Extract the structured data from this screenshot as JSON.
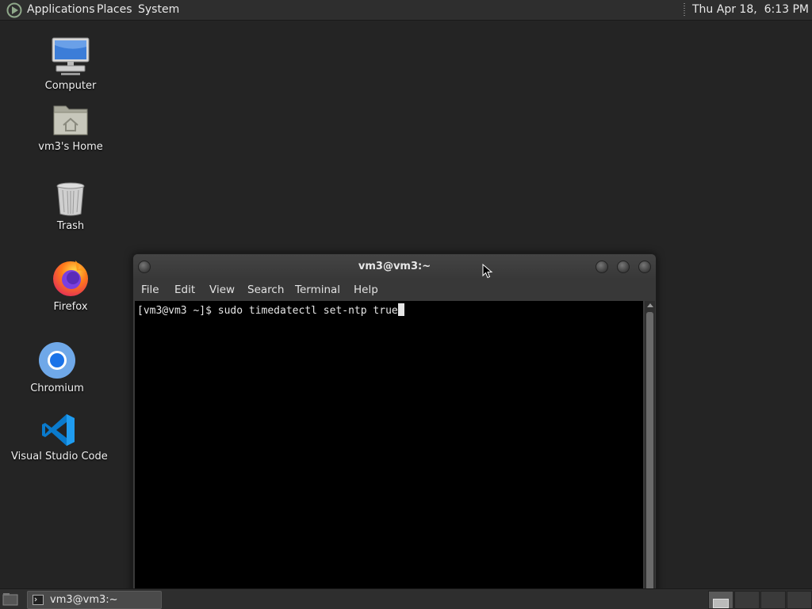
{
  "top_panel": {
    "menus": [
      "Applications",
      "Places",
      "System"
    ],
    "clock": "Thu Apr 18,  6:13 PM"
  },
  "desktop_icons": [
    {
      "label": "Computer",
      "icon": "computer-icon"
    },
    {
      "label": "vm3's Home",
      "icon": "home-folder-icon"
    },
    {
      "label": "Trash",
      "icon": "trash-icon"
    },
    {
      "label": "Firefox",
      "icon": "firefox-icon"
    },
    {
      "label": "Chromium",
      "icon": "chromium-icon"
    },
    {
      "label": "Visual Studio Code",
      "icon": "vscode-icon"
    }
  ],
  "terminal": {
    "title": "vm3@vm3:~",
    "menu": [
      "File",
      "Edit",
      "View",
      "Search",
      "Terminal",
      "Help"
    ],
    "lines": [
      "[vm3@vm3 ~]$ sudo timedatectl set-ntp true"
    ]
  },
  "taskbar": {
    "items": [
      {
        "label": "vm3@vm3:~",
        "icon": "terminal-icon"
      }
    ]
  },
  "colors": {
    "desktop_bg": "#242424",
    "panel_bg": "#2e2e2e",
    "terminal_bg": "#000000",
    "terminal_fg": "#e5e5e5"
  }
}
